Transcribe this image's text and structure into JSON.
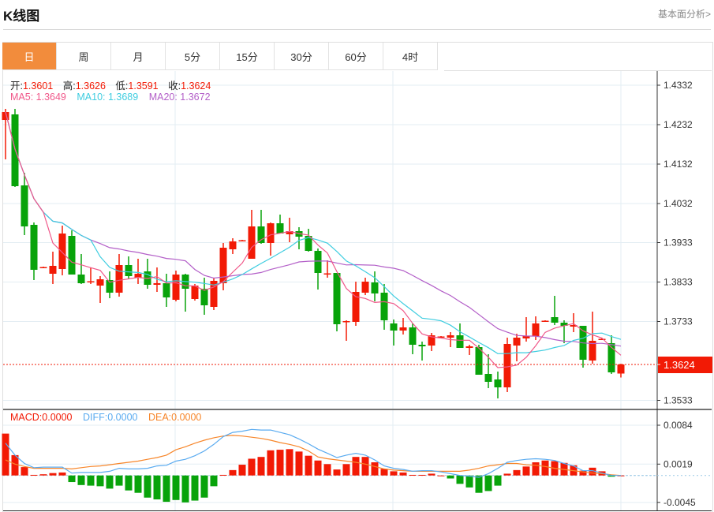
{
  "header": {
    "title": "K线图",
    "link": "基本面分析>"
  },
  "tabs": [
    {
      "label": "日",
      "active": true
    },
    {
      "label": "周"
    },
    {
      "label": "月"
    },
    {
      "label": "5分"
    },
    {
      "label": "15分"
    },
    {
      "label": "30分"
    },
    {
      "label": "60分"
    },
    {
      "label": "4时"
    }
  ],
  "ohlc_legend": {
    "open_label": "开:",
    "open": "1.3601",
    "high_label": "高:",
    "high": "1.3626",
    "low_label": "低:",
    "low": "1.3591",
    "close_label": "收:",
    "close": "1.3624"
  },
  "ma_legend": {
    "ma5": "MA5: 1.3649",
    "ma10": "MA10: 1.3689",
    "ma20": "MA20: 1.3672"
  },
  "macd_legend": {
    "macd": "MACD:0.0000",
    "diff": "DIFF:0.0000",
    "dea": "DEA:0.0000"
  },
  "colors": {
    "up": "#f21a05",
    "down": "#08a30a",
    "ma5": "#f0588a",
    "ma10": "#3fcde0",
    "ma20": "#b35fc8",
    "diff": "#5aabf0",
    "dea": "#f7862a",
    "accent": "#f28c3c"
  },
  "chart_data": {
    "type": "candlestick",
    "price_ticks": [
      "1.4332",
      "1.4232",
      "1.4132",
      "1.4032",
      "1.3933",
      "1.3833",
      "1.3733",
      "1.3533"
    ],
    "price_range": [
      1.3533,
      1.4332
    ],
    "last_price": "1.3624",
    "candles": [
      [
        1.4244,
        1.4272,
        1.4144,
        1.4264
      ],
      [
        1.4258,
        1.4272,
        1.4074,
        1.4076
      ],
      [
        1.4078,
        1.411,
        1.3952,
        1.3974
      ],
      [
        1.3978,
        1.3984,
        1.3838,
        1.3864
      ],
      [
        1.387,
        1.3872,
        1.3868,
        1.3871
      ],
      [
        1.3854,
        1.391,
        1.3828,
        1.3874
      ],
      [
        1.3866,
        1.3976,
        1.385,
        1.3956
      ],
      [
        1.395,
        1.3964,
        1.3852,
        1.3852
      ],
      [
        1.3852,
        1.3904,
        1.3828,
        1.383
      ],
      [
        1.3834,
        1.387,
        1.3828,
        1.3835
      ],
      [
        1.3824,
        1.3848,
        1.378,
        1.384
      ],
      [
        1.3838,
        1.386,
        1.3792,
        1.3806
      ],
      [
        1.3806,
        1.3904,
        1.3796,
        1.3876
      ],
      [
        1.3876,
        1.3898,
        1.384,
        1.3848
      ],
      [
        1.3844,
        1.3892,
        1.3828,
        1.3854
      ],
      [
        1.386,
        1.3892,
        1.3816,
        1.3826
      ],
      [
        1.3826,
        1.387,
        1.3808,
        1.383
      ],
      [
        1.383,
        1.3854,
        1.377,
        1.3794
      ],
      [
        1.3788,
        1.3862,
        1.3784,
        1.3852
      ],
      [
        1.3852,
        1.3854,
        1.3758,
        1.3816
      ],
      [
        1.379,
        1.3828,
        1.3786,
        1.3824
      ],
      [
        1.3816,
        1.3844,
        1.375,
        1.3774
      ],
      [
        1.377,
        1.3842,
        1.3762,
        1.3836
      ],
      [
        1.383,
        1.3932,
        1.3812,
        1.392
      ],
      [
        1.3916,
        1.3944,
        1.3904,
        1.3936
      ],
      [
        1.3938,
        1.394,
        1.3936,
        1.3939
      ],
      [
        1.3892,
        1.4016,
        1.3892,
        1.3974
      ],
      [
        1.3974,
        1.4016,
        1.393,
        1.3932
      ],
      [
        1.3932,
        1.3984,
        1.39,
        1.3982
      ],
      [
        1.3982,
        1.4004,
        1.3956,
        1.3956
      ],
      [
        1.3954,
        1.3996,
        1.3934,
        1.3962
      ],
      [
        1.3962,
        1.3972,
        1.3916,
        1.3948
      ],
      [
        1.395,
        1.3968,
        1.391,
        1.3912
      ],
      [
        1.3912,
        1.3918,
        1.3814,
        1.3856
      ],
      [
        1.3854,
        1.3888,
        1.3844,
        1.3855
      ],
      [
        1.3856,
        1.3856,
        1.3708,
        1.3726
      ],
      [
        1.3732,
        1.3736,
        1.3684,
        1.3734
      ],
      [
        1.3732,
        1.3834,
        1.3722,
        1.3808
      ],
      [
        1.3806,
        1.3844,
        1.38,
        1.3834
      ],
      [
        1.3832,
        1.386,
        1.3784,
        1.3804
      ],
      [
        1.3806,
        1.3828,
        1.3712,
        1.3736
      ],
      [
        1.3728,
        1.3738,
        1.3672,
        1.371
      ],
      [
        1.371,
        1.3742,
        1.37,
        1.3718
      ],
      [
        1.3718,
        1.3728,
        1.365,
        1.3674
      ],
      [
        1.3674,
        1.3682,
        1.3634,
        1.367
      ],
      [
        1.3672,
        1.3704,
        1.3658,
        1.3698
      ],
      [
        1.3694,
        1.3696,
        1.3693,
        1.3695
      ],
      [
        1.3692,
        1.3706,
        1.3668,
        1.3698
      ],
      [
        1.3698,
        1.3728,
        1.3666,
        1.3666
      ],
      [
        1.3666,
        1.3674,
        1.3648,
        1.367
      ],
      [
        1.3668,
        1.3674,
        1.3598,
        1.3598
      ],
      [
        1.36,
        1.365,
        1.3564,
        1.358
      ],
      [
        1.3586,
        1.3606,
        1.3538,
        1.3566
      ],
      [
        1.3566,
        1.3692,
        1.3554,
        1.3676
      ],
      [
        1.3672,
        1.3702,
        1.3632,
        1.3692
      ],
      [
        1.369,
        1.3744,
        1.3682,
        1.3696
      ],
      [
        1.3696,
        1.3746,
        1.3686,
        1.3728
      ],
      [
        1.3734,
        1.3736,
        1.3733,
        1.3735
      ],
      [
        1.3744,
        1.3798,
        1.3724,
        1.373
      ],
      [
        1.373,
        1.3736,
        1.3678,
        1.3722
      ],
      [
        1.372,
        1.3754,
        1.3706,
        1.3724
      ],
      [
        1.3722,
        1.3722,
        1.3616,
        1.3636
      ],
      [
        1.3634,
        1.3758,
        1.3626,
        1.3684
      ],
      [
        1.3688,
        1.369,
        1.3687,
        1.3689
      ],
      [
        1.3678,
        1.3698,
        1.36,
        1.3604
      ],
      [
        1.3601,
        1.3626,
        1.3591,
        1.3624
      ]
    ],
    "macd_ticks": [
      "0.0084",
      "0.0019",
      "-0.0045"
    ],
    "macd_hist": [
      0.007,
      0.0034,
      0.0014,
      0.0001,
      0.0002,
      0.0004,
      0.0005,
      -0.0011,
      -0.0016,
      -0.0017,
      -0.0018,
      -0.0022,
      -0.0017,
      -0.0025,
      -0.0029,
      -0.0037,
      -0.004,
      -0.0044,
      -0.0041,
      -0.0045,
      -0.0042,
      -0.0037,
      -0.0018,
      0.0001,
      0.0009,
      0.0018,
      0.0028,
      0.0031,
      0.0042,
      0.0043,
      0.0044,
      0.004,
      0.0033,
      0.0025,
      0.0019,
      0.001,
      0.0019,
      0.0031,
      0.0031,
      0.0022,
      0.0011,
      0.0007,
      0.0005,
      0.0001,
      0.0001,
      0.0003,
      0.0,
      -0.0005,
      -0.0014,
      -0.002,
      -0.0029,
      -0.0026,
      -0.0017,
      0.0003,
      0.0009,
      0.0015,
      0.0022,
      0.0025,
      0.0024,
      0.0021,
      0.0017,
      0.0008,
      0.0013,
      0.0007,
      -0.0002,
      0.0
    ],
    "diff": [
      0.0054,
      0.0034,
      0.002,
      0.0013,
      0.0014,
      0.0014,
      0.0014,
      0.0004,
      0.0005,
      0.0005,
      0.0005,
      0.0007,
      0.0012,
      0.0011,
      0.0011,
      0.0012,
      0.0016,
      0.0017,
      0.0024,
      0.0027,
      0.0033,
      0.0041,
      0.0052,
      0.0065,
      0.0072,
      0.0074,
      0.0077,
      0.0076,
      0.0076,
      0.0072,
      0.0068,
      0.0061,
      0.0053,
      0.0044,
      0.0037,
      0.003,
      0.0034,
      0.0037,
      0.0034,
      0.0026,
      0.0016,
      0.0012,
      0.001,
      0.0007,
      0.0008,
      0.0008,
      0.0006,
      0.0003,
      0.0,
      -0.0001,
      -0.0003,
      0.0003,
      0.0012,
      0.0022,
      0.0025,
      0.0027,
      0.0028,
      0.0027,
      0.0025,
      0.002,
      0.0016,
      0.0008,
      0.0008,
      0.0004,
      0.0,
      0.0
    ],
    "dea": [
      0.0026,
      0.0019,
      0.0015,
      0.0012,
      0.0012,
      0.0012,
      0.0012,
      0.0011,
      0.0013,
      0.0015,
      0.0016,
      0.0018,
      0.002,
      0.0022,
      0.0024,
      0.0027,
      0.003,
      0.0034,
      0.0043,
      0.0048,
      0.0054,
      0.0059,
      0.0063,
      0.0066,
      0.0067,
      0.0066,
      0.0064,
      0.0062,
      0.0059,
      0.0055,
      0.0052,
      0.0048,
      0.0041,
      0.0031,
      0.0028,
      0.0026,
      0.0024,
      0.0022,
      0.0019,
      0.0015,
      0.0011,
      0.0009,
      0.0008,
      0.0007,
      0.0007,
      0.0007,
      0.0007,
      0.0007,
      0.0007,
      0.0009,
      0.0012,
      0.0016,
      0.0018,
      0.002,
      0.002,
      0.0018,
      0.0017,
      0.0015,
      0.0012,
      0.001,
      0.0008,
      0.0006,
      0.0004,
      0.0003,
      0.0001,
      0.0
    ]
  }
}
